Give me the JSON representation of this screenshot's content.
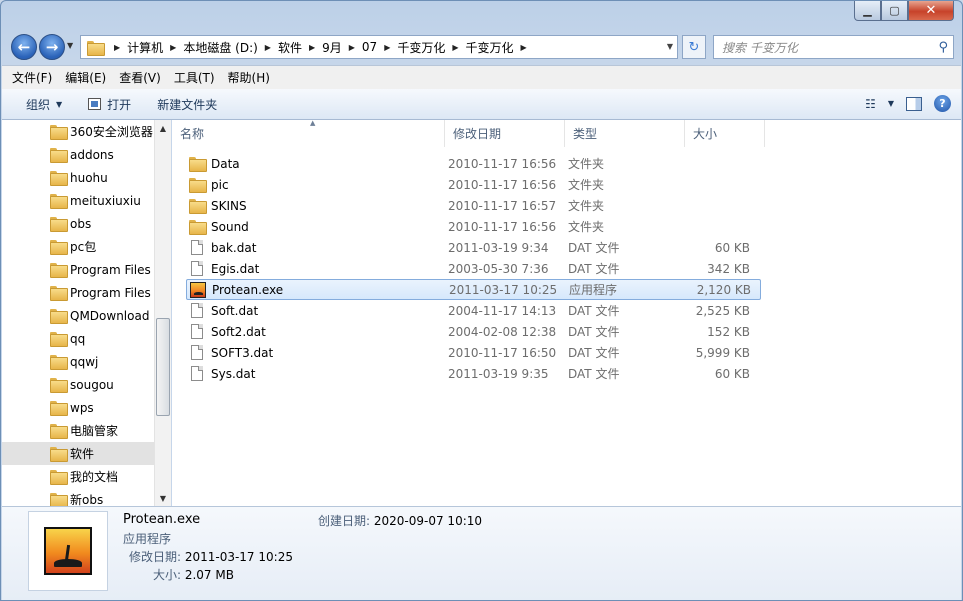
{
  "window": {
    "buttons": {
      "min": "▁",
      "max": "▢",
      "close": "✕"
    }
  },
  "address": {
    "crumbs": [
      "计算机",
      "本地磁盘 (D:)",
      "软件",
      "9月",
      "07",
      "千变万化",
      "千变万化"
    ]
  },
  "search": {
    "placeholder": "搜索 千变万化"
  },
  "menu": [
    "文件(F)",
    "编辑(E)",
    "查看(V)",
    "工具(T)",
    "帮助(H)"
  ],
  "toolbar": {
    "organize": "组织",
    "open": "打开",
    "new_folder": "新建文件夹"
  },
  "nav": {
    "items": [
      {
        "label": "360安全浏览器"
      },
      {
        "label": "addons"
      },
      {
        "label": "huohu"
      },
      {
        "label": "meituxiuxiu"
      },
      {
        "label": "obs"
      },
      {
        "label": "pc包"
      },
      {
        "label": "Program Files"
      },
      {
        "label": "Program Files"
      },
      {
        "label": "QMDownload"
      },
      {
        "label": "qq"
      },
      {
        "label": "qqwj"
      },
      {
        "label": "sougou"
      },
      {
        "label": "wps"
      },
      {
        "label": "电脑管家"
      },
      {
        "label": "软件"
      },
      {
        "label": "我的文档"
      },
      {
        "label": "新obs"
      }
    ]
  },
  "columns": {
    "name": "名称",
    "date": "修改日期",
    "type": "类型",
    "size": "大小"
  },
  "files": [
    {
      "name": "Data",
      "date": "2010-11-17 16:56",
      "type": "文件夹",
      "size": "",
      "icon": "folder-icon"
    },
    {
      "name": "pic",
      "date": "2010-11-17 16:56",
      "type": "文件夹",
      "size": "",
      "icon": "folder-icon"
    },
    {
      "name": "SKINS",
      "date": "2010-11-17 16:57",
      "type": "文件夹",
      "size": "",
      "icon": "folder-icon"
    },
    {
      "name": "Sound",
      "date": "2010-11-17 16:56",
      "type": "文件夹",
      "size": "",
      "icon": "folder-icon"
    },
    {
      "name": "bak.dat",
      "date": "2011-03-19 9:34",
      "type": "DAT 文件",
      "size": "60 KB",
      "icon": "file-icon"
    },
    {
      "name": "Egis.dat",
      "date": "2003-05-30 7:36",
      "type": "DAT 文件",
      "size": "342 KB",
      "icon": "file-icon"
    },
    {
      "name": "Protean.exe",
      "date": "2011-03-17 10:25",
      "type": "应用程序",
      "size": "2,120 KB",
      "icon": "exe-icon"
    },
    {
      "name": "Soft.dat",
      "date": "2004-11-17 14:13",
      "type": "DAT 文件",
      "size": "2,525 KB",
      "icon": "file-icon"
    },
    {
      "name": "Soft2.dat",
      "date": "2004-02-08 12:38",
      "type": "DAT 文件",
      "size": "152 KB",
      "icon": "file-icon"
    },
    {
      "name": "SOFT3.dat",
      "date": "2010-11-17 16:50",
      "type": "DAT 文件",
      "size": "5,999 KB",
      "icon": "file-icon"
    },
    {
      "name": "Sys.dat",
      "date": "2011-03-19 9:35",
      "type": "DAT 文件",
      "size": "60 KB",
      "icon": "file-icon"
    }
  ],
  "details": {
    "name": "Protean.exe",
    "type": "应用程序",
    "modified_label": "修改日期:",
    "modified": "2011-03-17 10:25",
    "size_label": "大小:",
    "size": "2.07 MB",
    "created_label": "创建日期:",
    "created": "2020-09-07 10:10"
  }
}
